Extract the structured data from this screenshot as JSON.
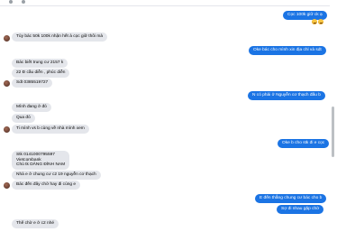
{
  "messages": [
    {
      "id": "m1",
      "side": "out",
      "text": "Cọc 100k giữ ck ạ"
    },
    {
      "id": "m2",
      "side": "in",
      "text": "Tùy bác 50k 100k nhận hết à cọc giữ thôi mà"
    },
    {
      "id": "m3",
      "side": "out",
      "text": "Oke bác cho mình xin địa chỉ và sdt"
    },
    {
      "id": "m4",
      "side": "in",
      "text": "Bác biết trung cư 2157 k"
    },
    {
      "id": "m5",
      "side": "in",
      "text": "22 Đ cầu diễn , phúc diễn"
    },
    {
      "id": "m6",
      "side": "in",
      "text": "Sdt 0385519727"
    },
    {
      "id": "m7",
      "side": "out",
      "text": "N có phải ở Nguyễn cơ thạch đấu b"
    },
    {
      "id": "m8",
      "side": "in",
      "text": "Mình đang ở đó"
    },
    {
      "id": "m9",
      "side": "in",
      "text": "Qua đó"
    },
    {
      "id": "m10",
      "side": "in",
      "text": "Ti mình vs b cùng về nhà mình xem"
    },
    {
      "id": "m11",
      "side": "out",
      "text": "Oke b cho stk đi e cọc"
    },
    {
      "id": "m12",
      "side": "in",
      "lines": [
        "Stk 0141000795597",
        "Vietcombank",
        "Chủ tk DĂNG ĐÌNH NAM"
      ]
    },
    {
      "id": "m13",
      "side": "in",
      "text": "Nhà e ở chung cư c2 19 nguyễn cơ thạch"
    },
    {
      "id": "m14",
      "side": "in",
      "text": "Bác đến đây chờ hay đi cùng e"
    },
    {
      "id": "m15",
      "side": "out",
      "text": "E đến thẳng chung cư bác cho b"
    },
    {
      "id": "m16",
      "side": "out",
      "text": "Sợ đi nhau gặp chờ"
    },
    {
      "id": "m17",
      "side": "in",
      "text": "Thế chờ e ở c2 nhé"
    }
  ],
  "colors": {
    "outgoing": "#1b74e4",
    "incoming": "#e4e6eb",
    "background": "#ffffff"
  }
}
